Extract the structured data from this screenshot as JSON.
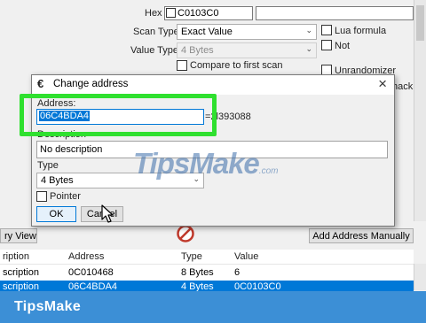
{
  "scan_panel": {
    "hex_label": "Hex",
    "hex_value": "C0103C0",
    "scan_type_label": "Scan Type",
    "scan_type_value": "Exact Value",
    "value_type_label": "Value Type",
    "value_type_value": "4 Bytes",
    "compare_first_label": "Compare to first scan",
    "lua_formula_label": "Lua formula",
    "not_label": "Not",
    "unrandomizer_label": "Unrandomizer",
    "hack_label": "hack"
  },
  "dialog": {
    "title": "Change address",
    "address_label": "Address:",
    "address_value": "06C4BDA4",
    "address_resolved": "=2l393088",
    "description_label": "Description",
    "description_value": "No description",
    "type_label": "Type",
    "type_value": "4 Bytes",
    "pointer_label": "Pointer",
    "ok_label": "OK",
    "cancel_label": "Cancel"
  },
  "toolbar": {
    "memory_view_label": "ry View",
    "add_address_label": "Add Address Manually"
  },
  "table": {
    "headers": [
      "ription",
      "Address",
      "Type",
      "Value"
    ],
    "rows": [
      {
        "description": "scription",
        "address": "0C010468",
        "type": "8 Bytes",
        "value": "6",
        "selected": false
      },
      {
        "description": "scription",
        "address": "06C4BDA4",
        "type": "4 Bytes",
        "value": "0C0103C0",
        "selected": true
      }
    ]
  },
  "watermark": {
    "main": "TipsMake",
    "ext": ".com"
  },
  "footer": {
    "brand": "TipsMake"
  },
  "colors": {
    "highlight_box": "#2fe02f",
    "selection": "#0078d7",
    "footer_bg": "#3c8fd6",
    "stop_icon": "#c0392b"
  }
}
